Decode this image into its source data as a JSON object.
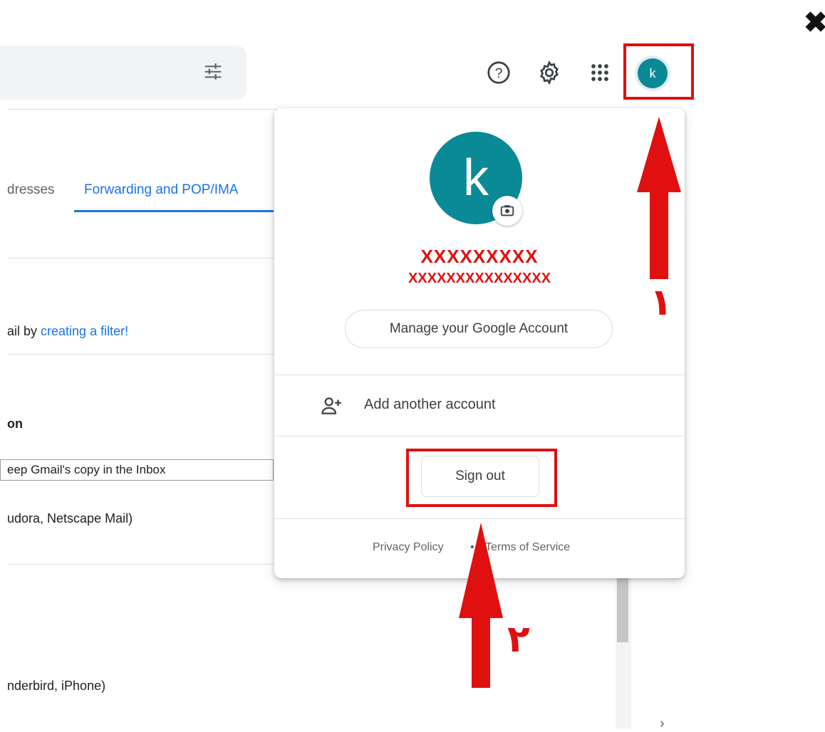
{
  "window": {
    "close_glyph": "✖"
  },
  "header": {
    "search_options_icon": "tune-icon",
    "help_icon": "?",
    "settings_icon": "gear-icon",
    "apps_icon": "apps-icon",
    "account_initial": "k"
  },
  "settings_page": {
    "tabs": [
      {
        "label": "dresses"
      },
      {
        "label": "Forwarding and POP/IMA"
      }
    ],
    "filter_text_prefix": "ail by ",
    "filter_link": "creating a filter!",
    "section_heading": "on",
    "select_value": "eep Gmail's copy in the Inbox",
    "pop_clients": "udora, Netscape Mail)",
    "imap_clients": "nderbird, iPhone)"
  },
  "account_popup": {
    "initial": "k",
    "masked_name": "XXXXXXXXX",
    "masked_email": "XXXXXXXXXXXXXXX",
    "manage_button": "Manage your Google Account",
    "add_account": "Add another account",
    "sign_out": "Sign out",
    "privacy_policy": "Privacy Policy",
    "separator": "•",
    "terms": "Terms of Service"
  },
  "annotations": {
    "step1": "۱",
    "step2": "۲",
    "color": "#e01010"
  }
}
